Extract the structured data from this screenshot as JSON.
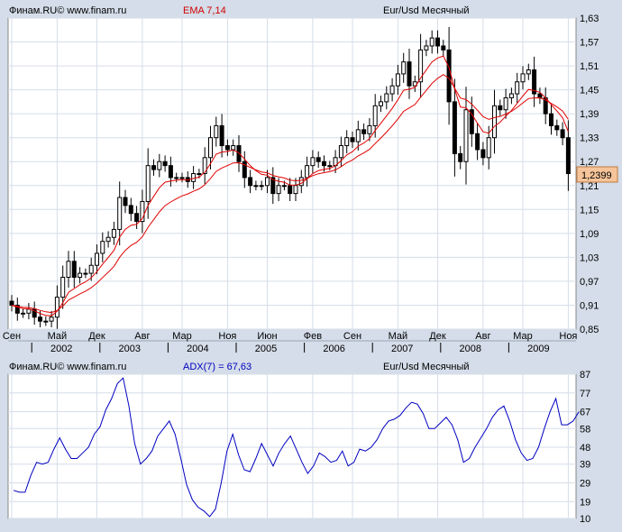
{
  "top_panel": {
    "source": "Финам.RU© www.finam.ru",
    "indicator": "EMA 7,14",
    "instrument": "Eur/Usd Месячный",
    "last_price": "1,2399",
    "y_ticks": [
      "0,85",
      "0,91",
      "0,97",
      "1,03",
      "1,09",
      "1,15",
      "1,21",
      "1,27",
      "1,33",
      "1,39",
      "1,45",
      "1,51",
      "1,57",
      "1,63"
    ]
  },
  "bottom_panel": {
    "source": "Финам.RU© www.finam.ru",
    "indicator": "ADX(7) = 67,63",
    "instrument": "Eur/Usd Месячный",
    "y_ticks": [
      "10",
      "19",
      "29",
      "39",
      "48",
      "58",
      "67",
      "77",
      "87"
    ]
  },
  "x_axis": {
    "months": [
      {
        "label": "Сен",
        "i": 0
      },
      {
        "label": "Май",
        "i": 8
      },
      {
        "label": "Дек",
        "i": 15
      },
      {
        "label": "Авг",
        "i": 23
      },
      {
        "label": "Мар",
        "i": 30
      },
      {
        "label": "Ноя",
        "i": 38
      },
      {
        "label": "Июн",
        "i": 45
      },
      {
        "label": "Фев",
        "i": 53
      },
      {
        "label": "Сен",
        "i": 60
      },
      {
        "label": "Май",
        "i": 68
      },
      {
        "label": "Дек",
        "i": 75
      },
      {
        "label": "Авг",
        "i": 83
      },
      {
        "label": "Мар",
        "i": 90
      },
      {
        "label": "Ноя",
        "i": 98
      }
    ],
    "years": [
      {
        "label": "2002",
        "i": 4
      },
      {
        "label": "2003",
        "i": 16
      },
      {
        "label": "2004",
        "i": 28
      },
      {
        "label": "2005",
        "i": 40
      },
      {
        "label": "2006",
        "i": 52
      },
      {
        "label": "2007",
        "i": 64
      },
      {
        "label": "2008",
        "i": 76
      },
      {
        "label": "2009",
        "i": 88
      }
    ]
  },
  "colors": {
    "background": "#d4dde9",
    "plot_bg": "#ffffff",
    "grid": "#d6dee8",
    "up_candle": "#ffffff",
    "down_candle": "#000000",
    "ema_fast": "#e00000",
    "ema_slow": "#e00000",
    "adx_line": "#0000c0",
    "title_indicator": "#d00000",
    "adx_label": "#0000c0",
    "last_price_box": "#f6c49a"
  },
  "chart_data": [
    {
      "type": "candlestick",
      "title": "Eur/Usd Месячный",
      "indicator": "EMA 7,14",
      "ylim": [
        0.85,
        1.63
      ],
      "grid": true,
      "period_start": "2001-09",
      "period_end": "2010-01",
      "closes": [
        0.91,
        0.89,
        0.89,
        0.9,
        0.88,
        0.87,
        0.87,
        0.88,
        0.93,
        0.98,
        1.02,
        0.98,
        0.99,
        0.99,
        1.01,
        1.04,
        1.07,
        1.08,
        1.1,
        1.18,
        1.16,
        1.14,
        1.12,
        1.17,
        1.26,
        1.25,
        1.27,
        1.26,
        1.23,
        1.23,
        1.23,
        1.22,
        1.24,
        1.24,
        1.28,
        1.33,
        1.36,
        1.31,
        1.3,
        1.31,
        1.27,
        1.23,
        1.21,
        1.21,
        1.21,
        1.23,
        1.19,
        1.21,
        1.21,
        1.19,
        1.21,
        1.23,
        1.26,
        1.28,
        1.27,
        1.26,
        1.26,
        1.28,
        1.31,
        1.33,
        1.32,
        1.35,
        1.34,
        1.36,
        1.41,
        1.42,
        1.44,
        1.46,
        1.49,
        1.52,
        1.46,
        1.47,
        1.55,
        1.56,
        1.58,
        1.56,
        1.55,
        1.42,
        1.29,
        1.27,
        1.4,
        1.34,
        1.3,
        1.28,
        1.33,
        1.41,
        1.4,
        1.43,
        1.44,
        1.47,
        1.49,
        1.5,
        1.44,
        1.43,
        1.39,
        1.36,
        1.35,
        1.33,
        1.24
      ],
      "series": [
        {
          "name": "EMA 7",
          "role": "ema_fast"
        },
        {
          "name": "EMA 14",
          "role": "ema_slow"
        }
      ]
    },
    {
      "type": "line",
      "title": "Eur/Usd Месячный",
      "indicator": "ADX(7) = 67,63",
      "ylim": [
        10,
        87
      ],
      "grid": true,
      "series": [
        {
          "name": "ADX(7)",
          "values": [
            25,
            24,
            24,
            33,
            40,
            39,
            40,
            47,
            53,
            47,
            42,
            42,
            45,
            48,
            55,
            59,
            68,
            74,
            82,
            85,
            70,
            50,
            39,
            42,
            46,
            54,
            58,
            62,
            55,
            42,
            28,
            20,
            16,
            14,
            11,
            15,
            29,
            46,
            55,
            44,
            36,
            35,
            42,
            50,
            44,
            38,
            45,
            50,
            54,
            47,
            40,
            34,
            38,
            45,
            43,
            40,
            41,
            46,
            38,
            40,
            47,
            46,
            48,
            52,
            58,
            62,
            63,
            65,
            69,
            72,
            71,
            66,
            58,
            58,
            61,
            64,
            60,
            52,
            40,
            42,
            48,
            53,
            58,
            64,
            68,
            70,
            62,
            52,
            45,
            41,
            42,
            48,
            58,
            67,
            74,
            60,
            60,
            62,
            67
          ]
        }
      ]
    }
  ]
}
